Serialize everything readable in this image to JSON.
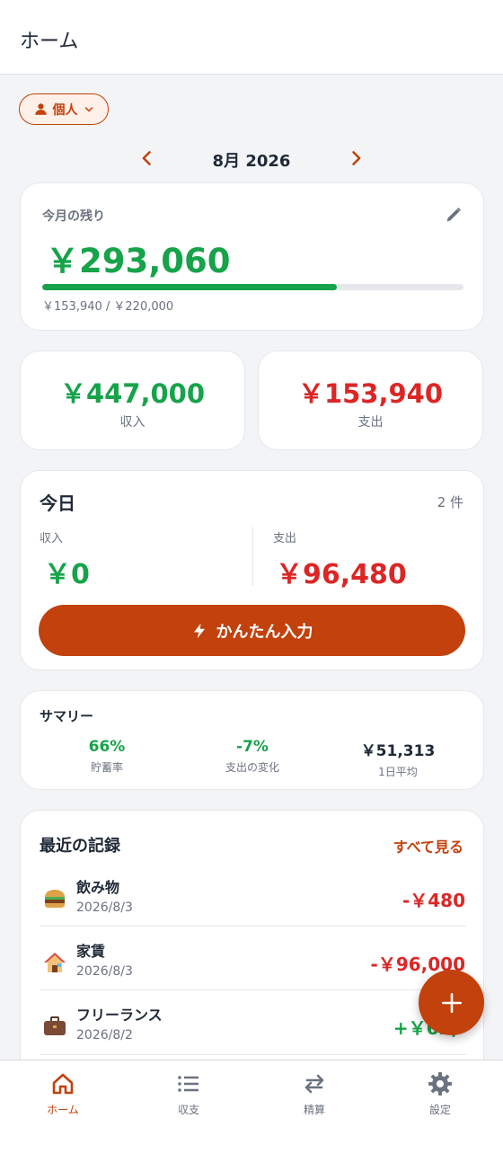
{
  "colors": {
    "accent": "#c2410c",
    "income": "#16a34a",
    "expense": "#dc2626",
    "muted": "#6b7280",
    "background": "#f3f4f6"
  },
  "appbar": {
    "title": "ホーム"
  },
  "scope": {
    "label": "個人",
    "icon": "user-icon"
  },
  "month": {
    "label": "8月 2026"
  },
  "remaining": {
    "title": "今月の残り",
    "amount": "￥293,060",
    "progress_fraction": 0.6997,
    "sub": "￥153,940 / ￥220,000"
  },
  "stats": {
    "income": {
      "value": "￥447,000",
      "label": "収入"
    },
    "expense": {
      "value": "￥153,940",
      "label": "支出"
    }
  },
  "today": {
    "title": "今日",
    "count": "2 件",
    "income_label": "収入",
    "income_value": "￥0",
    "expense_label": "支出",
    "expense_value": "￥96,480",
    "quick_button": "かんたん入力"
  },
  "summary": {
    "title": "サマリー",
    "items": [
      {
        "value": "66%",
        "label": "貯蓄率"
      },
      {
        "value": "-7%",
        "label": "支出の変化"
      },
      {
        "value": "￥51,313",
        "label": "1日平均"
      }
    ]
  },
  "recent": {
    "title": "最近の記録",
    "see_all": "すべて見る",
    "items": [
      {
        "name": "飲み物",
        "date": "2026/8/3",
        "amount": "-￥480",
        "icon": "burger-icon"
      },
      {
        "name": "家賃",
        "date": "2026/8/3",
        "amount": "-￥96,000",
        "icon": "house-icon"
      },
      {
        "name": "フリーランス",
        "date": "2026/8/2",
        "amount": "+￥62,",
        "icon": "briefcase-icon"
      }
    ]
  },
  "fab": {
    "icon": "plus-icon"
  },
  "nav": {
    "items": [
      {
        "label": "ホーム",
        "icon": "home-icon",
        "active": true
      },
      {
        "label": "収支",
        "icon": "list-icon",
        "active": false
      },
      {
        "label": "精算",
        "icon": "transfer-icon",
        "active": false
      },
      {
        "label": "設定",
        "icon": "gear-icon",
        "active": false
      }
    ]
  }
}
